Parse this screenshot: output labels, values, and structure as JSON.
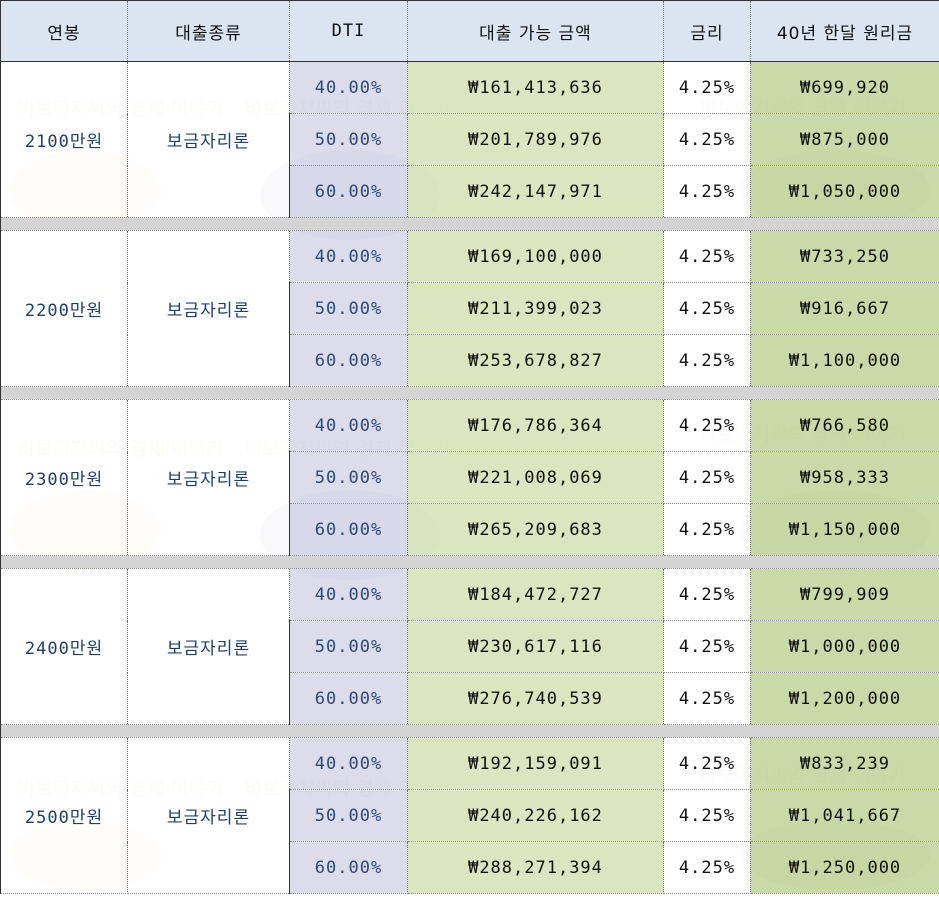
{
  "headers": {
    "salary": "연봉",
    "loan_type": "대출종류",
    "dti": "DTI",
    "amount": "대출 가능 금액",
    "rate": "금리",
    "monthly": "40년 한달 원리금"
  },
  "watermark_text": "바보아저씨의 경제 이야기",
  "colors": {
    "header_bg": "#dbe5f1",
    "dti_bg": "#d6d6e8",
    "amount_bg": "#d8e4bc",
    "monthly_bg": "#c4d6a0",
    "separator_bg": "#d4d4d4",
    "label_text": "#1f3f68"
  },
  "groups": [
    {
      "salary": "2100만원",
      "loan_type": "보금자리론",
      "rows": [
        {
          "dti": "40.00%",
          "amount": "₩161,413,636",
          "rate": "4.25%",
          "monthly": "₩699,920"
        },
        {
          "dti": "50.00%",
          "amount": "₩201,789,976",
          "rate": "4.25%",
          "monthly": "₩875,000"
        },
        {
          "dti": "60.00%",
          "amount": "₩242,147,971",
          "rate": "4.25%",
          "monthly": "₩1,050,000"
        }
      ]
    },
    {
      "salary": "2200만원",
      "loan_type": "보금자리론",
      "rows": [
        {
          "dti": "40.00%",
          "amount": "₩169,100,000",
          "rate": "4.25%",
          "monthly": "₩733,250"
        },
        {
          "dti": "50.00%",
          "amount": "₩211,399,023",
          "rate": "4.25%",
          "monthly": "₩916,667"
        },
        {
          "dti": "60.00%",
          "amount": "₩253,678,827",
          "rate": "4.25%",
          "monthly": "₩1,100,000"
        }
      ]
    },
    {
      "salary": "2300만원",
      "loan_type": "보금자리론",
      "rows": [
        {
          "dti": "40.00%",
          "amount": "₩176,786,364",
          "rate": "4.25%",
          "monthly": "₩766,580"
        },
        {
          "dti": "50.00%",
          "amount": "₩221,008,069",
          "rate": "4.25%",
          "monthly": "₩958,333"
        },
        {
          "dti": "60.00%",
          "amount": "₩265,209,683",
          "rate": "4.25%",
          "monthly": "₩1,150,000"
        }
      ]
    },
    {
      "salary": "2400만원",
      "loan_type": "보금자리론",
      "rows": [
        {
          "dti": "40.00%",
          "amount": "₩184,472,727",
          "rate": "4.25%",
          "monthly": "₩799,909"
        },
        {
          "dti": "50.00%",
          "amount": "₩230,617,116",
          "rate": "4.25%",
          "monthly": "₩1,000,000"
        },
        {
          "dti": "60.00%",
          "amount": "₩276,740,539",
          "rate": "4.25%",
          "monthly": "₩1,200,000"
        }
      ]
    },
    {
      "salary": "2500만원",
      "loan_type": "보금자리론",
      "rows": [
        {
          "dti": "40.00%",
          "amount": "₩192,159,091",
          "rate": "4.25%",
          "monthly": "₩833,239"
        },
        {
          "dti": "50.00%",
          "amount": "₩240,226,162",
          "rate": "4.25%",
          "monthly": "₩1,041,667"
        },
        {
          "dti": "60.00%",
          "amount": "₩288,271,394",
          "rate": "4.25%",
          "monthly": "₩1,250,000"
        }
      ]
    }
  ]
}
